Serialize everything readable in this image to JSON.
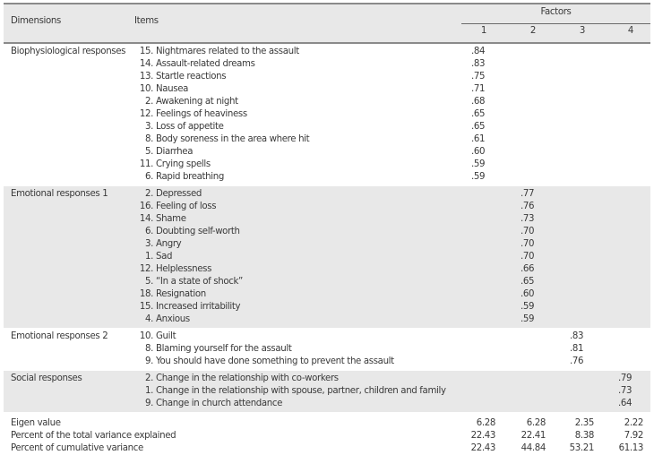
{
  "header": {
    "dimensions": "Dimensions",
    "items": "Items",
    "factors": "Factors",
    "factor_numbers": [
      "1",
      "2",
      "3",
      "4"
    ]
  },
  "groups": [
    {
      "dimension": "Biophysiological responses",
      "factor": 1,
      "rows": [
        {
          "num": "15.",
          "text": "Nightmares related to the assault",
          "loading": ".84"
        },
        {
          "num": "14.",
          "text": "Assault-related dreams",
          "loading": ".83"
        },
        {
          "num": "13.",
          "text": "Startle reactions",
          "loading": ".75"
        },
        {
          "num": "10.",
          "text": "Nausea",
          "loading": ".71"
        },
        {
          "num": "2.",
          "text": "Awakening at night",
          "loading": ".68"
        },
        {
          "num": "12.",
          "text": "Feelings of heaviness",
          "loading": ".65"
        },
        {
          "num": "3.",
          "text": "Loss of appetite",
          "loading": ".65"
        },
        {
          "num": "8.",
          "text": "Body soreness in the area where hit",
          "loading": ".61"
        },
        {
          "num": "5.",
          "text": "Diarrhea",
          "loading": ".60"
        },
        {
          "num": "11.",
          "text": "Crying spells",
          "loading": ".59"
        },
        {
          "num": "6.",
          "text": "Rapid breathing",
          "loading": ".59"
        }
      ]
    },
    {
      "dimension": "Emotional responses 1",
      "factor": 2,
      "rows": [
        {
          "num": "2.",
          "text": "Depressed",
          "loading": ".77"
        },
        {
          "num": "16.",
          "text": "Feeling of loss",
          "loading": ".76"
        },
        {
          "num": "14.",
          "text": "Shame",
          "loading": ".73"
        },
        {
          "num": "6.",
          "text": "Doubting self-worth",
          "loading": ".70"
        },
        {
          "num": "3.",
          "text": "Angry",
          "loading": ".70"
        },
        {
          "num": "1.",
          "text": "Sad",
          "loading": ".70"
        },
        {
          "num": "12.",
          "text": "Helplessness",
          "loading": ".66"
        },
        {
          "num": "5.",
          "text": "“In a state of shock”",
          "loading": ".65"
        },
        {
          "num": "18.",
          "text": "Resignation",
          "loading": ".60"
        },
        {
          "num": "15.",
          "text": "Increased irritability",
          "loading": ".59"
        },
        {
          "num": "4.",
          "text": "Anxious",
          "loading": ".59"
        }
      ]
    },
    {
      "dimension": "Emotional responses 2",
      "factor": 3,
      "rows": [
        {
          "num": "10.",
          "text": "Guilt",
          "loading": ".83"
        },
        {
          "num": "8.",
          "text": "Blaming yourself for the assault",
          "loading": ".81"
        },
        {
          "num": "9.",
          "text": "You should have done something to prevent the assault",
          "loading": ".76"
        }
      ]
    },
    {
      "dimension": "Social responses",
      "factor": 4,
      "rows": [
        {
          "num": "2.",
          "text": "Change in the relationship with co-workers",
          "loading": ".79"
        },
        {
          "num": "1.",
          "text": "Change in the relationship with spouse, partner, children and family",
          "loading": ".73"
        },
        {
          "num": "9.",
          "text": "Change in church attendance",
          "loading": ".64"
        }
      ]
    }
  ],
  "stats": [
    {
      "label": "Eigen value",
      "values": [
        "6.28",
        "6.28",
        "2.35",
        "2.22"
      ]
    },
    {
      "label": "Percent of the total variance explained",
      "values": [
        "22.43",
        "22.41",
        "8.38",
        "7.92"
      ]
    },
    {
      "label": "Percent of cumulative variance",
      "values": [
        "22.43",
        "44.84",
        "53.21",
        "61.13"
      ]
    }
  ]
}
